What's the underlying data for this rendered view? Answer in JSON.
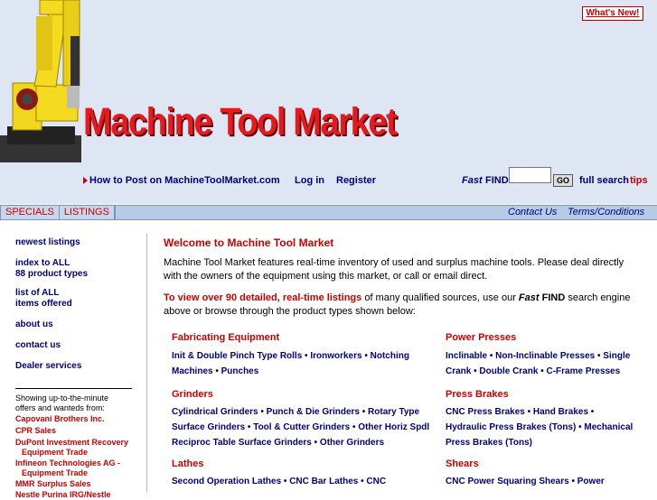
{
  "header": {
    "whats_new": "What's New!",
    "site_title": "Machine Tool Market",
    "how_to_post": "How to Post on MachineToolMarket.com",
    "login": "Log in",
    "register": "Register",
    "fast": "Fast",
    "find": "FIND",
    "go": "GO",
    "full_search": "full search",
    "tips": "tips"
  },
  "nav": {
    "tabs": [
      "SPECIALS",
      "LISTINGS"
    ],
    "contact_us": "Contact Us",
    "terms": "Terms/Conditions"
  },
  "sidebar": {
    "links": [
      {
        "line1": "newest listings",
        "line2": ""
      },
      {
        "line1": "index to ALL",
        "line2": "88 product types"
      },
      {
        "line1": "list of ALL",
        "line2": "items offered"
      },
      {
        "line1": "about us",
        "line2": ""
      },
      {
        "line1": "contact us",
        "line2": ""
      },
      {
        "line1": "Dealer services",
        "line2": ""
      }
    ],
    "note_line1": "Showing up-to-the-minute",
    "note_line2": "offers and wanteds from:",
    "dealers": [
      "Capovani Brothers Inc.",
      "CPR Sales",
      "DuPont Investment Recovery",
      "Equipment Trade",
      "Infineon Technologies AG -",
      "Equipment Trade",
      "MMR Surplus Sales",
      "Nestle Purina IRG/Nestle"
    ]
  },
  "main": {
    "welcome": "Welcome to Machine Tool Market",
    "intro": "Machine Tool Market features real-time inventory of used and surplus machine tools. Please deal directly with the owners of the equipment using this market, or call or email direct.",
    "view_red": "To view over 90 detailed, real-time listings",
    "view_mid": " of many qualified sources, use our ",
    "view_fast": "Fast",
    "view_find": " FIND",
    "view_end": " search engine above or browse through the product types shown below:"
  },
  "categories": {
    "fabricating": {
      "title": "Fabricating Equipment",
      "line1": "Init & Double Pinch Type Rolls • Ironworkers • Notching",
      "line2": "Machines • Punches"
    },
    "power_presses": {
      "title": "Power Presses",
      "line1": "Inclinable • Non-Inclinable Presses • Single",
      "line2": "Crank • Double Crank • C-Frame Presses"
    },
    "grinders": {
      "title": "Grinders",
      "line1": "Cylindrical Grinders • Punch & Die Grinders • Rotary Type",
      "line2": "Surface Grinders • Tool & Cutter Grinders • Other Horiz Spdl",
      "line3": "Reciproc Table Surface Grinders • Other Grinders"
    },
    "press_brakes": {
      "title": "Press Brakes",
      "line1": "CNC Press Brakes • Hand Brakes •",
      "line2": "Hydraulic Press Brakes (Tons) • Mechanical",
      "line3": "Press Brakes (Tons)"
    },
    "lathes": {
      "title": "Lathes",
      "line1": "Second Operation Lathes • CNC Bar Lathes • CNC"
    },
    "shears": {
      "title": "Shears",
      "line1": "CNC Power Squaring Shears • Power"
    }
  }
}
